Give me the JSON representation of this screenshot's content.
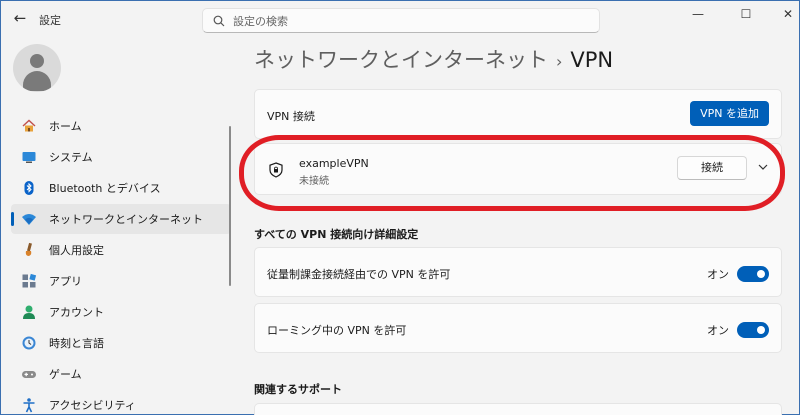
{
  "window": {
    "title": "設定",
    "back": "←",
    "minimize": "—",
    "maximize": "☐",
    "close": "✕"
  },
  "search": {
    "placeholder": "設定の検索"
  },
  "breadcrumb": {
    "parent": "ネットワークとインターネット",
    "separator": "›",
    "current": "VPN"
  },
  "sidebar": {
    "items": [
      {
        "label": "ホーム",
        "icon": "home-icon"
      },
      {
        "label": "システム",
        "icon": "system-icon"
      },
      {
        "label": "Bluetooth とデバイス",
        "icon": "bluetooth-icon"
      },
      {
        "label": "ネットワークとインターネット",
        "icon": "wifi-icon",
        "active": true
      },
      {
        "label": "個人用設定",
        "icon": "brush-icon"
      },
      {
        "label": "アプリ",
        "icon": "apps-icon"
      },
      {
        "label": "アカウント",
        "icon": "account-icon"
      },
      {
        "label": "時刻と言語",
        "icon": "time-language-icon"
      },
      {
        "label": "ゲーム",
        "icon": "game-icon"
      },
      {
        "label": "アクセシビリティ",
        "icon": "accessibility-icon"
      }
    ]
  },
  "vpn_connections": {
    "label": "VPN 接続",
    "add_button": "VPN を追加"
  },
  "vpn_item": {
    "name": "exampleVPN",
    "status": "未接続",
    "connect_button": "接続"
  },
  "advanced": {
    "heading": "すべての VPN 接続向け詳細設定",
    "metered": {
      "label": "従量制課金接続経由での VPN を許可",
      "state": "オン",
      "on": true
    },
    "roaming": {
      "label": "ローミング中の VPN を許可",
      "state": "オン",
      "on": true
    }
  },
  "related": {
    "heading": "関連するサポート"
  },
  "colors": {
    "accent": "#005fb8",
    "highlight": "#e01e25"
  }
}
